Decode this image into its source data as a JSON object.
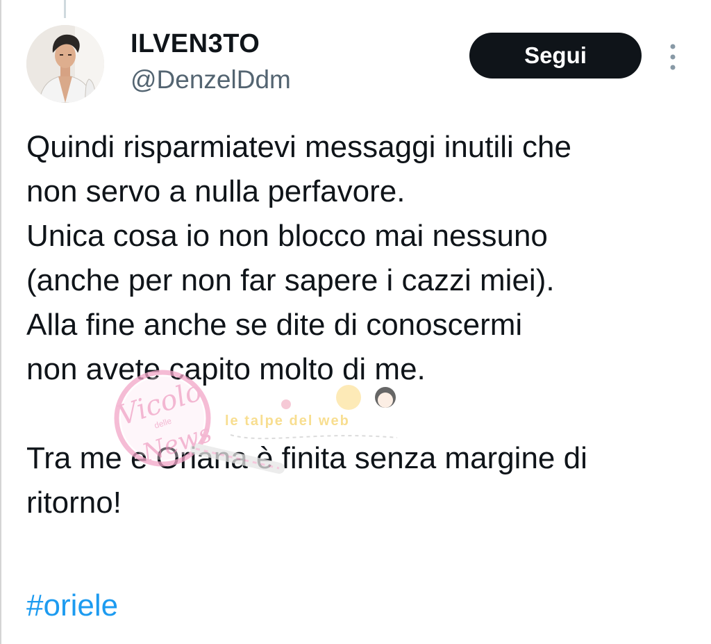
{
  "author": {
    "display_name": "ILVEN3TO",
    "handle": "@DenzelDdm",
    "avatar_icon": "profile-photo"
  },
  "actions": {
    "follow_label": "Segui",
    "more_icon": "more-vertical-icon"
  },
  "tweet": {
    "lines": [
      "Quindi risparmiatevi messaggi inutili che",
      "non servo a nulla perfavore.",
      "Unica cosa io non blocco mai nessuno",
      "(anche per non far sapere i cazzi miei).",
      "Alla fine anche se dite di conoscermi",
      "non avete capito molto di me.",
      "Tra me e Oriana è finita senza margine di",
      "ritorno!"
    ],
    "hashtag": "#oriele"
  },
  "watermark": {
    "left_logo_text": "Vicolo delle News",
    "right_logo_text": "le talpe del web"
  },
  "colors": {
    "text": "#0f1419",
    "secondary": "#536471",
    "link": "#1d9bf0",
    "button_bg": "#0f1419",
    "button_text": "#ffffff"
  }
}
